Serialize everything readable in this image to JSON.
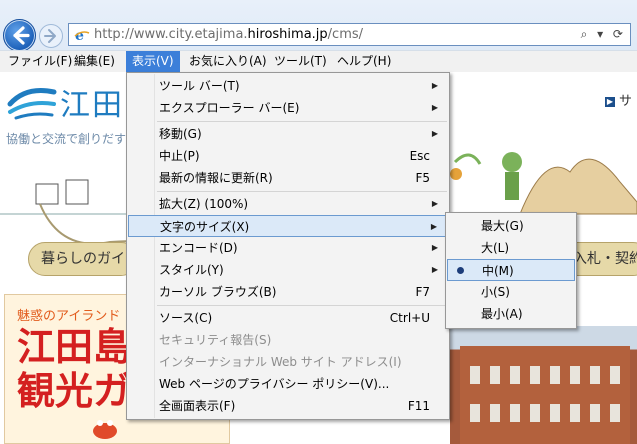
{
  "browser": {
    "url_prefix": "http://www.city.etajima.",
    "url_domain": "hiroshima.jp",
    "url_suffix": "/cms/",
    "address_icons": "⌕ ▾ ⟳"
  },
  "menubar": {
    "items": [
      {
        "label": "ファイル(F)"
      },
      {
        "label": "編集(E)"
      },
      {
        "label": "表示(V)"
      },
      {
        "label": "お気に入り(A)"
      },
      {
        "label": "ツール(T)"
      },
      {
        "label": "ヘルプ(H)"
      }
    ]
  },
  "view_menu": {
    "items": [
      {
        "label": "ツール バー(T)",
        "shortcut": "",
        "submenu": true,
        "disabled": false
      },
      {
        "label": "エクスプローラー バー(E)",
        "shortcut": "",
        "submenu": true,
        "disabled": false
      },
      {
        "label": "移動(G)",
        "shortcut": "",
        "submenu": true,
        "disabled": false
      },
      {
        "label": "中止(P)",
        "shortcut": "Esc",
        "submenu": false,
        "disabled": false
      },
      {
        "label": "最新の情報に更新(R)",
        "shortcut": "F5",
        "submenu": false,
        "disabled": false
      },
      {
        "label": "拡大(Z) (100%)",
        "shortcut": "",
        "submenu": true,
        "disabled": false
      },
      {
        "label": "文字のサイズ(X)",
        "shortcut": "",
        "submenu": true,
        "disabled": false
      },
      {
        "label": "エンコード(D)",
        "shortcut": "",
        "submenu": true,
        "disabled": false
      },
      {
        "label": "スタイル(Y)",
        "shortcut": "",
        "submenu": true,
        "disabled": false
      },
      {
        "label": "カーソル ブラウズ(B)",
        "shortcut": "F7",
        "submenu": false,
        "disabled": false
      },
      {
        "label": "ソース(C)",
        "shortcut": "Ctrl+U",
        "submenu": false,
        "disabled": false
      },
      {
        "label": "セキュリティ報告(S)",
        "shortcut": "",
        "submenu": false,
        "disabled": true
      },
      {
        "label": "インターナショナル Web サイト アドレス(I)",
        "shortcut": "",
        "submenu": false,
        "disabled": true
      },
      {
        "label": "Web ページのプライバシー ポリシー(V)...",
        "shortcut": "",
        "submenu": false,
        "disabled": false
      },
      {
        "label": "全画面表示(F)",
        "shortcut": "F11",
        "submenu": false,
        "disabled": false
      }
    ]
  },
  "text_size_menu": {
    "items": [
      {
        "label": "最大(G)",
        "selected": false
      },
      {
        "label": "大(L)",
        "selected": false
      },
      {
        "label": "中(M)",
        "selected": true
      },
      {
        "label": "小(S)",
        "selected": false
      },
      {
        "label": "最小(A)",
        "selected": false
      }
    ]
  },
  "site": {
    "logo_text": "江田",
    "tagline": "協働と交流で創りだす",
    "top_link": "サ",
    "nav_left": "暮らしのガイ",
    "nav_right": "入札・契約",
    "banner_sub": "魅惑のアイランド",
    "banner_line1": "江田島",
    "banner_line2": "観光ガ"
  },
  "colors": {
    "menu_active": "#3c7fd9",
    "highlight_bg": "#dbe9f8",
    "highlight_border": "#6b9ad0",
    "site_blue": "#1f7cc0",
    "banner_red": "#d42020"
  }
}
